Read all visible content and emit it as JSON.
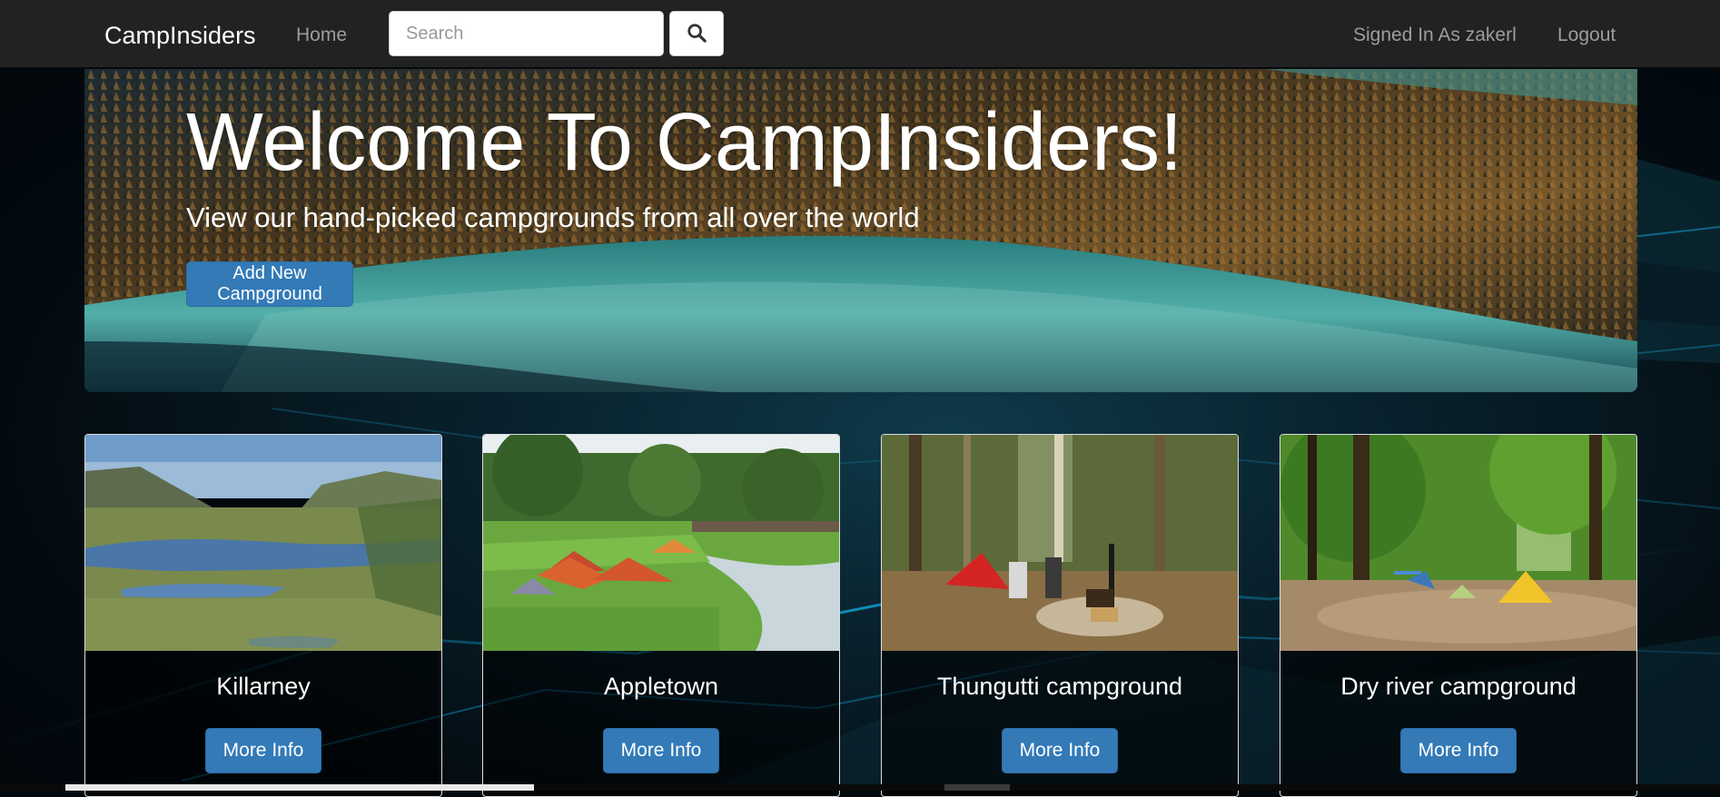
{
  "navbar": {
    "brand": "CampInsiders",
    "home_label": "Home",
    "search": {
      "placeholder": "Search",
      "value": ""
    },
    "search_icon": "search-icon",
    "signed_in_label": "Signed In As zakerl",
    "logout_label": "Logout"
  },
  "jumbotron": {
    "title": "Welcome To CampInsiders!",
    "subtitle": "View our hand-picked campgrounds from all over the world",
    "add_button_label": "Add New Campground"
  },
  "campgrounds": [
    {
      "name": "Killarney",
      "button_label": "More Info"
    },
    {
      "name": "Appletown",
      "button_label": "More Info"
    },
    {
      "name": "Thungutti campground",
      "button_label": "More Info"
    },
    {
      "name": "Dry river campground",
      "button_label": "More Info"
    }
  ],
  "colors": {
    "navbar_bg": "#222222",
    "primary_button": "#337ab7",
    "page_bg": "#020a0e"
  }
}
